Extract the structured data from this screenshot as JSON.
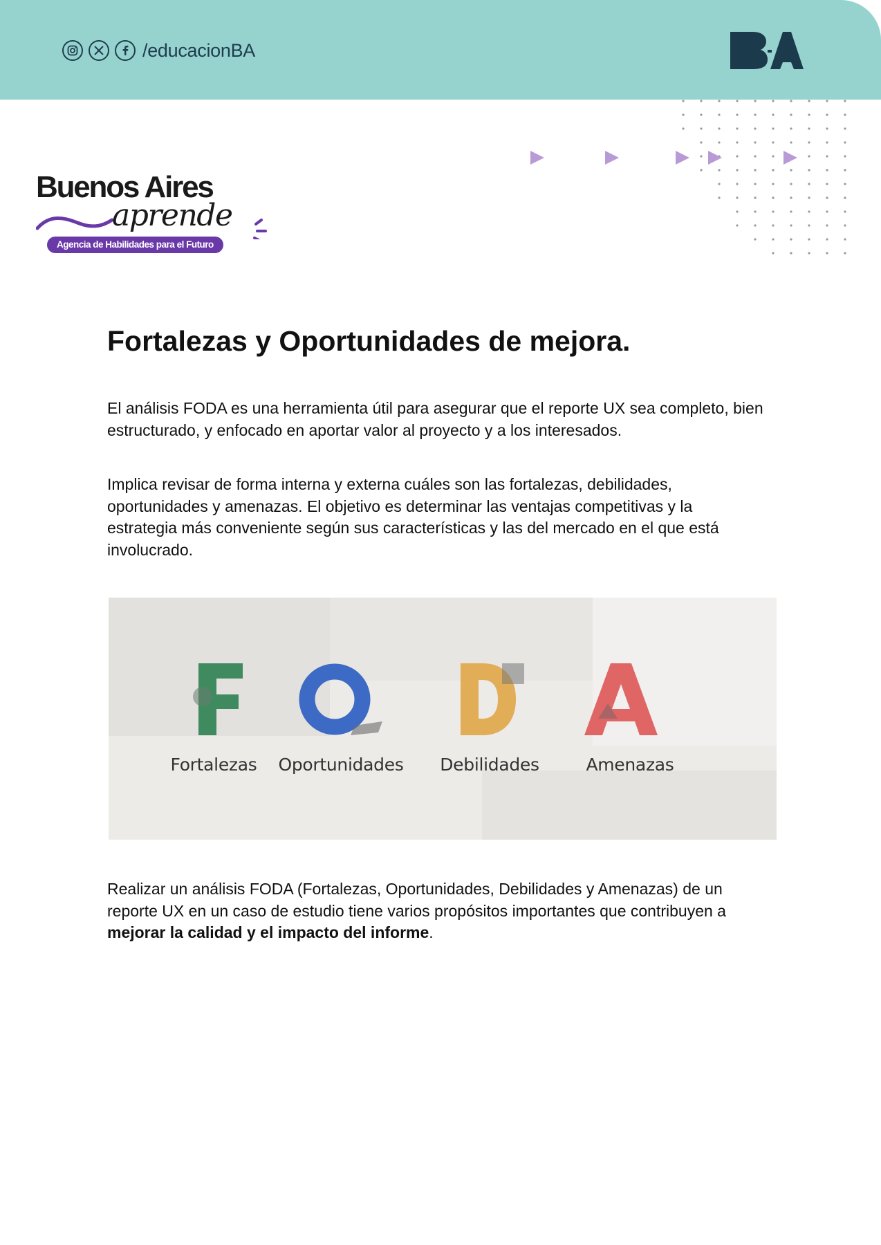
{
  "header": {
    "social_handle": "/educacionBA",
    "social_icons": [
      "instagram-icon",
      "x-icon",
      "facebook-icon"
    ],
    "logo_text": "BA",
    "background_color": "#96d3cf",
    "logo_color": "#1b3a4b"
  },
  "brand": {
    "title": "Buenos Aires",
    "subtitle": "aprende",
    "tagline": "Agencia de Habilidades para el Futuro",
    "accent_color": "#6a39a8"
  },
  "content": {
    "heading": "Fortalezas y Oportunidades de mejora.",
    "paragraph_1": "El análisis FODA es una herramienta útil para asegurar que el reporte UX sea completo, bien estructurado, y enfocado en aportar valor al proyecto y a los interesados.",
    "paragraph_2": "Implica revisar de forma interna y externa cuáles son las fortalezas, debilidades, oportunidades y amenazas. El objetivo es determinar las ventajas competitivas y la estrategia más conveniente según sus características y las del mercado en el que está involucrado.",
    "paragraph_3_intro": "Realizar un análisis FODA (Fortalezas, Oportunidades, Debilidades y Amenazas) de un reporte UX en un caso de estudio tiene varios propósitos importantes que contribuyen a ",
    "paragraph_3_bold": "mejorar la calidad y el impacto del informe",
    "paragraph_3_end": "."
  },
  "foda": {
    "items": [
      {
        "letter": "F",
        "label": "Fortalezas",
        "color": "#3f8a5f"
      },
      {
        "letter": "O",
        "label": "Oportunidades",
        "color": "#3c6ac4"
      },
      {
        "letter": "D",
        "label": "Debilidades",
        "color": "#e2ad57"
      },
      {
        "letter": "A",
        "label": "Amenazas",
        "color": "#e06565"
      }
    ]
  }
}
